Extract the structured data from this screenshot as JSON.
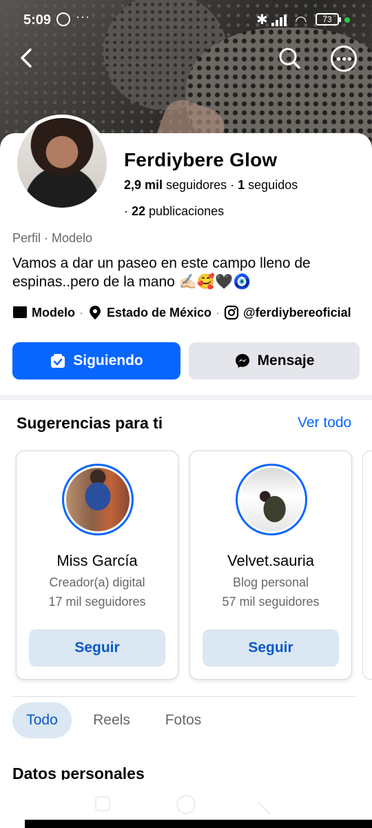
{
  "status_bar": {
    "time": "5:09",
    "dots": "···",
    "battery": "73"
  },
  "profile": {
    "name": "Ferdiybere Glow",
    "followers_count": "2,9 mil",
    "followers_label": "seguidores",
    "following_count": "1",
    "following_label": "seguidos",
    "posts_count": "22",
    "posts_label": "publicaciones",
    "category": "Perfil · Modelo",
    "bio": "Vamos a dar un paseo en este campo lleno de espinas..pero de la mano ✍🏻🥰🖤🧿",
    "details": {
      "job": "Modelo",
      "location": "Estado de México",
      "instagram": "@ferdiybereoficial"
    }
  },
  "actions": {
    "following_label": "Siguiendo",
    "message_label": "Mensaje"
  },
  "suggestions": {
    "title": "Sugerencias para ti",
    "see_all": "Ver todo",
    "items": [
      {
        "name": "Miss García",
        "subtitle": "Creador(a) digital",
        "followers": "17 mil seguidores",
        "button": "Seguir"
      },
      {
        "name": "Velvet.sauria",
        "subtitle": "Blog personal",
        "followers": "57 mil seguidores",
        "button": "Seguir"
      }
    ]
  },
  "tabs": [
    {
      "label": "Todo",
      "active": true
    },
    {
      "label": "Reels",
      "active": false
    },
    {
      "label": "Fotos",
      "active": false
    }
  ],
  "section": {
    "title": "Datos personales"
  },
  "colors": {
    "accent": "#0866ff",
    "secondary_button": "#e4e6eb",
    "soft_button": "#dbe7f2",
    "muted_text": "#65676b"
  }
}
